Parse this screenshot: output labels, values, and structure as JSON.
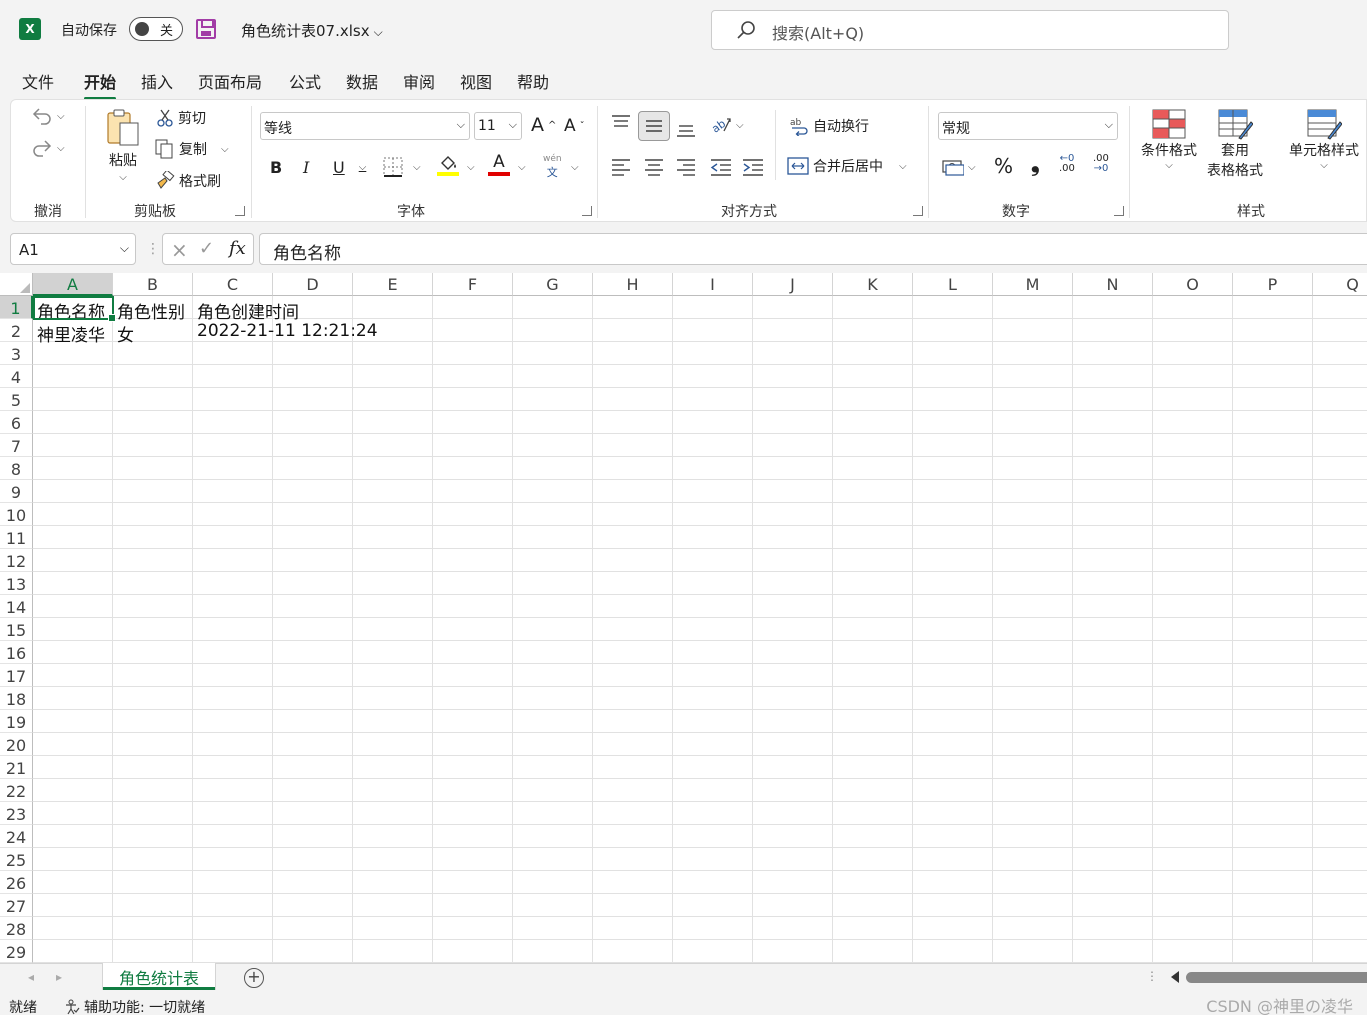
{
  "titlebar": {
    "app_icon": "excel-logo",
    "autosave_label": "自动保存",
    "autosave_state": "关",
    "filename": "角色统计表07.xlsx",
    "search_placeholder": "搜索(Alt+Q)"
  },
  "menu": {
    "tabs": [
      "文件",
      "开始",
      "插入",
      "页面布局",
      "公式",
      "数据",
      "审阅",
      "视图",
      "帮助"
    ],
    "active": "开始"
  },
  "ribbon": {
    "groups": {
      "undo": "撤消",
      "clipboard": "剪贴板",
      "font": "字体",
      "alignment": "对齐方式",
      "number": "数字",
      "styles": "样式"
    },
    "clipboard": {
      "paste": "粘贴",
      "cut": "剪切",
      "copy": "复制",
      "format_painter": "格式刷"
    },
    "font": {
      "family": "等线",
      "size": "11",
      "grow": "A",
      "shrink": "A",
      "bold": "B",
      "italic": "I",
      "underline": "U",
      "font_color_letter": "A",
      "phonetic_top": "wén",
      "phonetic_bottom": "文",
      "fill_color": "#ffff00",
      "font_color": "#e00000"
    },
    "alignment": {
      "wrap_text": "自动换行",
      "merge_center": "合并后居中"
    },
    "number": {
      "format": "常规",
      "percent": "%",
      "comma": "❟",
      "increase_decimal": ".00",
      "decrease_decimal": ".00"
    },
    "styles": {
      "conditional": "条件格式",
      "table_line1": "套用",
      "table_line2": "表格格式",
      "cell_styles": "单元格样式"
    }
  },
  "formula_bar": {
    "name_box": "A1",
    "fx": "fx",
    "content": "角色名称"
  },
  "grid": {
    "columns": [
      "A",
      "B",
      "C",
      "D",
      "E",
      "F",
      "G",
      "H",
      "I",
      "J",
      "K",
      "L",
      "M",
      "N",
      "O",
      "P",
      "Q"
    ],
    "rows": [
      "1",
      "2",
      "3",
      "4",
      "5",
      "6",
      "7",
      "8",
      "9",
      "10",
      "11",
      "12",
      "13",
      "14",
      "15",
      "16",
      "17",
      "18",
      "19",
      "20",
      "21",
      "22",
      "23",
      "24",
      "25",
      "26",
      "27",
      "28",
      "29"
    ],
    "selected_column": "A",
    "selected_row": "1",
    "cells": {
      "A1": "角色名称",
      "B1": "角色性别",
      "C1": "角色创建时间",
      "A2": "神里凌华",
      "B2": "女",
      "C2": "2022-21-11 12:21:24"
    }
  },
  "sheets": {
    "tabs": [
      "角色统计表"
    ],
    "active": "角色统计表",
    "add_label": "+"
  },
  "status": {
    "ready": "就绪",
    "accessibility": "辅助功能: 一切就绪",
    "watermark": "CSDN @神里の凌华"
  },
  "colors": {
    "accent": "#107c41",
    "brand_save": "#a23ca6"
  }
}
